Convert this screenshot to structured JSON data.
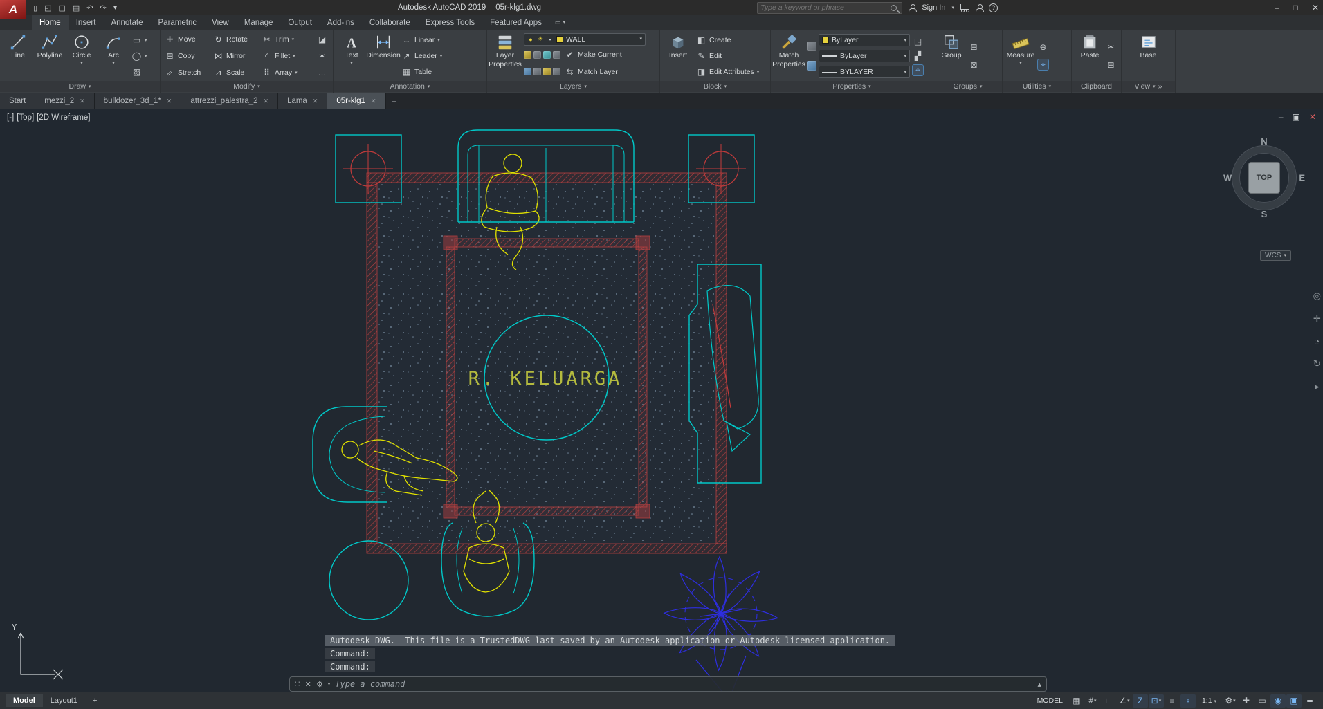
{
  "icons": {
    "logo": "A",
    "text_glyph": "A",
    "close": "✕",
    "caret": "▾",
    "chevron": "»",
    "minimize": "–",
    "maximize": "□",
    "restore": "▣",
    "help": "?",
    "gear": "⚙",
    "grip": "∷",
    "history_up": "▴",
    "plus": "+",
    "panel_toggle": "▭",
    "new": "▯",
    "open": "◱",
    "save": "◫",
    "plot": "▤",
    "undo": "↶",
    "redo": "↷",
    "nav_wheel": "◎",
    "nav_pan": "✛",
    "nav_zoom": "◔",
    "nav_orbit": "↻",
    "nav_motion": "▸"
  },
  "tool_icons": {
    "move": "✛",
    "rotate": "↻",
    "trim": "✂",
    "copy": "⊞",
    "mirror": "⋈",
    "fillet": "◜",
    "stretch": "⇗",
    "scale": "⊿",
    "array": "⠿",
    "erase": "◪",
    "explode": "✶",
    "more": "…",
    "rect": "▭",
    "ellipse": "◯",
    "hatch": "▨",
    "linear": "↔",
    "leader": "↗",
    "table": "▦",
    "bulb": "●",
    "sun": "☀",
    "lock": "▪",
    "make_current": "✔",
    "match_layer": "⇆",
    "create": "◧",
    "edit": "✎",
    "edit_attr": "◨",
    "prop_c": "◳",
    "prop_d": "▞",
    "select": "⌖",
    "ungroup": "⊟",
    "group_edit": "⊠",
    "id_point": "⊕",
    "quick_measure": "⌖",
    "cut": "✂",
    "copy_clip": "⊞"
  },
  "titlebar": {
    "app_name": "Autodesk AutoCAD 2019",
    "doc_name": "05r-klg1.dwg",
    "search_placeholder": "Type a keyword or phrase",
    "sign_in": "Sign In"
  },
  "ribbon_tabs": [
    "Home",
    "Insert",
    "Annotate",
    "Parametric",
    "View",
    "Manage",
    "Output",
    "Add-ins",
    "Collaborate",
    "Express Tools",
    "Featured Apps"
  ],
  "panels": {
    "draw": {
      "title": "Draw",
      "line": "Line",
      "polyline": "Polyline",
      "circle": "Circle",
      "arc": "Arc"
    },
    "modify": {
      "title": "Modify",
      "move": "Move",
      "rotate": "Rotate",
      "trim": "Trim",
      "copy": "Copy",
      "mirror": "Mirror",
      "fillet": "Fillet",
      "stretch": "Stretch",
      "scale": "Scale",
      "array": "Array"
    },
    "annotation": {
      "title": "Annotation",
      "text": "Text",
      "dimension": "Dimension",
      "linear": "Linear",
      "leader": "Leader",
      "table": "Table"
    },
    "layers": {
      "title": "Layers",
      "big_line1": "Layer",
      "big_line2": "Properties",
      "current": "WALL",
      "make_current": "Make Current",
      "match_layer": "Match Layer"
    },
    "block": {
      "title": "Block",
      "insert": "Insert",
      "create": "Create",
      "edit": "Edit",
      "edit_attributes": "Edit Attributes"
    },
    "properties": {
      "title": "Properties",
      "big_line1": "Match",
      "big_line2": "Properties",
      "color": "ByLayer",
      "lineweight": "ByLayer",
      "linetype": "BYLAYER"
    },
    "groups": {
      "title": "Groups",
      "group": "Group"
    },
    "utilities": {
      "title": "Utilities",
      "measure": "Measure"
    },
    "clipboard": {
      "title": "Clipboard",
      "paste": "Paste"
    },
    "view": {
      "title": "View",
      "base": "Base"
    }
  },
  "file_tabs": [
    "Start",
    "mezzi_2",
    "bulldozer_3d_1*",
    "attrezzi_palestra_2",
    "Lama",
    "05r-klg1"
  ],
  "viewport": {
    "control_minus": "[-]",
    "control_view": "[Top]",
    "control_style": "[2D Wireframe]",
    "navcube": {
      "n": "N",
      "w": "W",
      "e": "E",
      "s": "S",
      "top": "TOP"
    },
    "wcs": "WCS",
    "ucs_y": "Y",
    "room_label": "R. KELUARGA"
  },
  "command": {
    "line1": "Autodesk DWG.  This file is a TrustedDWG last saved by an Autodesk application or Autodesk licensed application.",
    "line2": "Command:",
    "line3": "Command:",
    "placeholder": "Type a command"
  },
  "statusbar": {
    "model": "Model",
    "layout1": "Layout1",
    "add_layout": "+",
    "space": "MODEL",
    "scale": "1:1",
    "icons": [
      {
        "name": "grid",
        "glyph": "▦"
      },
      {
        "name": "snap",
        "glyph": "#"
      },
      {
        "name": "ortho",
        "glyph": "∟"
      },
      {
        "name": "polar-tracking",
        "glyph": "∠"
      },
      {
        "name": "dynamic-input",
        "glyph": "Z"
      },
      {
        "name": "object-snap",
        "glyph": "⊡"
      },
      {
        "name": "lineweight",
        "glyph": "≡"
      },
      {
        "name": "selection-cycling",
        "glyph": "⌖"
      }
    ],
    "icons2": [
      {
        "name": "workspace",
        "glyph": "⚙"
      },
      {
        "name": "annotation-monitor",
        "glyph": "✚"
      },
      {
        "name": "quick-properties",
        "glyph": "▭"
      },
      {
        "name": "isolate-objects",
        "glyph": "◉"
      },
      {
        "name": "clean-screen",
        "glyph": "▣"
      },
      {
        "name": "customization",
        "glyph": "≣"
      }
    ]
  },
  "colors": {
    "canvas_bg": "#212830",
    "cad_cyan": "#00c8c8",
    "cad_red": "#b84040",
    "cad_yellow": "#e0e000",
    "cad_blue": "#2e2ee0",
    "room_text": "#b4ba3e",
    "accent_blue": "#5f9fd8"
  }
}
